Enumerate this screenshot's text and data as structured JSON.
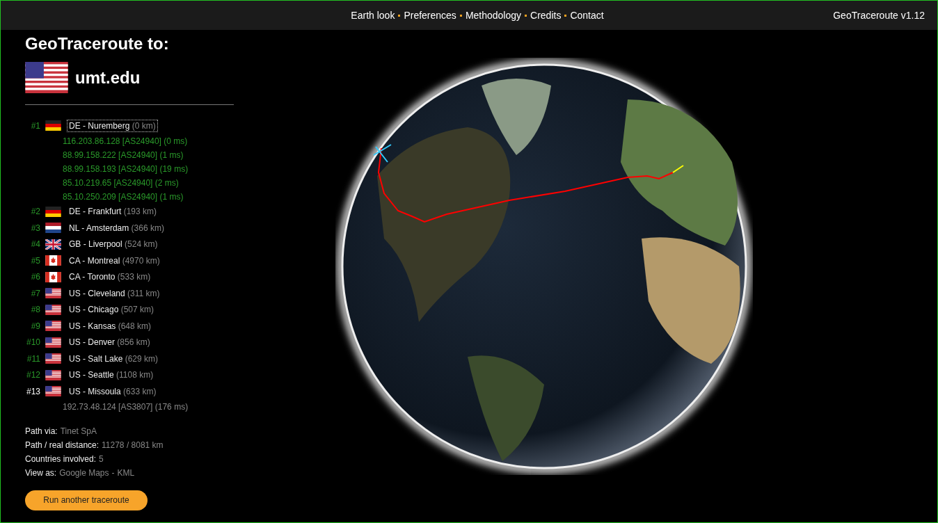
{
  "nav": {
    "links": [
      "Earth look",
      "Preferences",
      "Methodology",
      "Credits",
      "Contact"
    ],
    "version": "GeoTraceroute v1.12"
  },
  "title": "GeoTraceroute to:",
  "target": {
    "kind": "us",
    "host": "umt.edu"
  },
  "hops": [
    {
      "number": "#1",
      "kind": "de",
      "place": "DE - Nuremberg",
      "distance": "(0 km)",
      "selected": true,
      "final": false,
      "details": [
        "116.203.86.128 [AS24940] (0 ms)",
        "88.99.158.222 [AS24940] (1 ms)",
        "88.99.158.193 [AS24940] (19 ms)",
        "85.10.219.65 [AS24940] (2 ms)",
        "85.10.250.209 [AS24940] (1 ms)"
      ]
    },
    {
      "number": "#2",
      "kind": "de",
      "place": "DE - Frankfurt",
      "distance": "(193 km)",
      "selected": false,
      "final": false
    },
    {
      "number": "#3",
      "kind": "nl",
      "place": "NL - Amsterdam",
      "distance": "(366 km)",
      "selected": false,
      "final": false
    },
    {
      "number": "#4",
      "kind": "gb",
      "place": "GB - Liverpool",
      "distance": "(524 km)",
      "selected": false,
      "final": false
    },
    {
      "number": "#5",
      "kind": "ca",
      "place": "CA - Montreal",
      "distance": "(4970 km)",
      "selected": false,
      "final": false
    },
    {
      "number": "#6",
      "kind": "ca",
      "place": "CA - Toronto",
      "distance": "(533 km)",
      "selected": false,
      "final": false
    },
    {
      "number": "#7",
      "kind": "us",
      "place": "US - Cleveland",
      "distance": "(311 km)",
      "selected": false,
      "final": false
    },
    {
      "number": "#8",
      "kind": "us",
      "place": "US - Chicago",
      "distance": "(507 km)",
      "selected": false,
      "final": false
    },
    {
      "number": "#9",
      "kind": "us",
      "place": "US - Kansas",
      "distance": "(648 km)",
      "selected": false,
      "final": false
    },
    {
      "number": "#10",
      "kind": "us",
      "place": "US - Denver",
      "distance": "(856 km)",
      "selected": false,
      "final": false
    },
    {
      "number": "#11",
      "kind": "us",
      "place": "US - Salt Lake",
      "distance": "(629 km)",
      "selected": false,
      "final": false
    },
    {
      "number": "#12",
      "kind": "us",
      "place": "US - Seattle",
      "distance": "(1108 km)",
      "selected": false,
      "final": false
    },
    {
      "number": "#13",
      "kind": "us",
      "place": "US - Missoula",
      "distance": "(633 km)",
      "selected": false,
      "final": true,
      "details": [
        "192.73.48.124 [AS3807] (176 ms)"
      ]
    }
  ],
  "summary": [
    {
      "kind": "text",
      "label": "Path via:",
      "value": "Tinet SpA"
    },
    {
      "kind": "text",
      "label": "Path / real distance:",
      "value": "11278 / 8081 km"
    },
    {
      "kind": "text",
      "label": "Countries involved:",
      "value": "5"
    },
    {
      "kind": "links",
      "label": "View as:",
      "links": [
        "Google Maps",
        "KML"
      ],
      "separator": "-"
    }
  ],
  "button": "Run another traceroute"
}
